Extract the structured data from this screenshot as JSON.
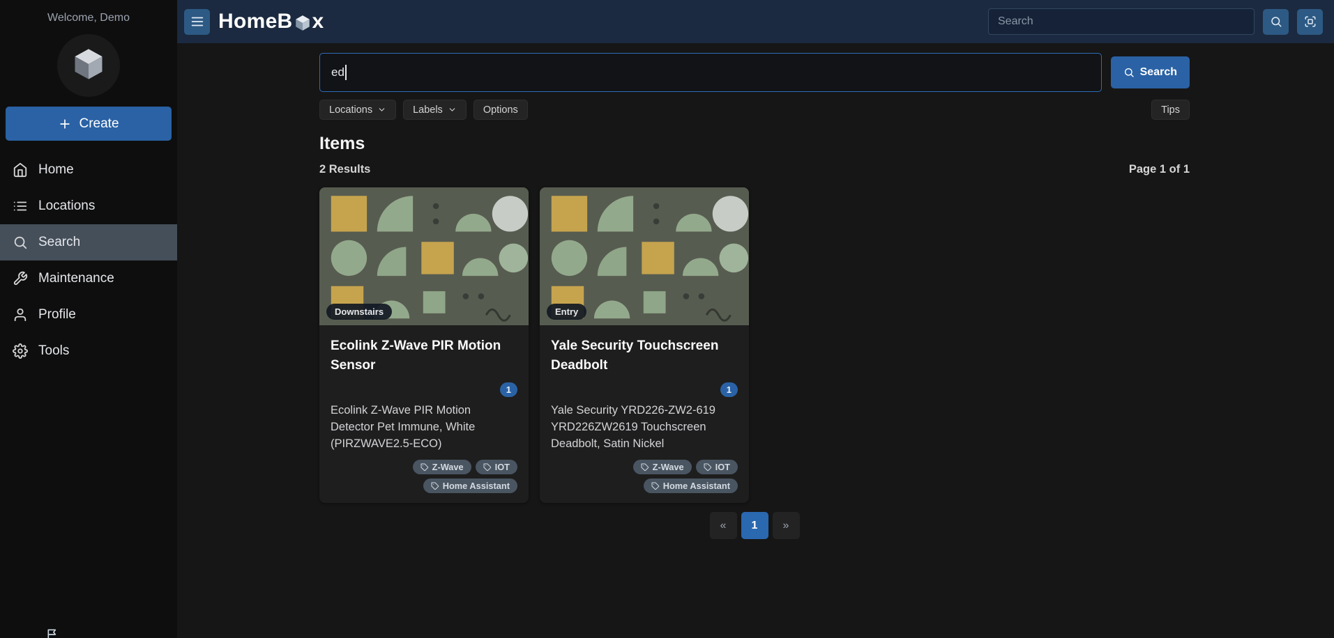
{
  "sidebar": {
    "welcome": "Welcome, Demo",
    "create_label": "Create",
    "items": [
      {
        "label": "Home"
      },
      {
        "label": "Locations"
      },
      {
        "label": "Search"
      },
      {
        "label": "Maintenance"
      },
      {
        "label": "Profile"
      },
      {
        "label": "Tools"
      }
    ]
  },
  "topbar": {
    "title_prefix": "HomeB",
    "title_suffix": "x",
    "search_placeholder": "Search"
  },
  "search_panel": {
    "query": "ed",
    "search_button": "Search",
    "filters": {
      "locations": "Locations",
      "labels": "Labels",
      "options": "Options"
    },
    "tips": "Tips"
  },
  "results": {
    "heading": "Items",
    "count_text": "2 Results",
    "page_text": "Page 1 of 1",
    "items": [
      {
        "location": "Downstairs",
        "title": "Ecolink Z-Wave PIR Motion Sensor",
        "quantity": "1",
        "description": "Ecolink Z-Wave PIR Motion Detector Pet Immune, White (PIRZWAVE2.5-ECO)",
        "labels": [
          "Z-Wave",
          "IOT",
          "Home Assistant"
        ]
      },
      {
        "location": "Entry",
        "title": "Yale Security Touchscreen Deadbolt",
        "quantity": "1",
        "description": "Yale Security YRD226-ZW2-619 YRD226ZW2619 Touchscreen Deadbolt, Satin Nickel",
        "labels": [
          "Z-Wave",
          "IOT",
          "Home Assistant"
        ]
      }
    ]
  },
  "pagination": {
    "prev": "«",
    "page": "1",
    "next": "»"
  },
  "colors": {
    "primary": "#2a62a5",
    "topbar_bg": "#1b2a40",
    "sidebar_bg": "#0e0e0e",
    "page_bg": "#161616",
    "card_bg": "#1e1e1e",
    "active_nav_bg": "#454f5a",
    "focus_border": "#2e6cb8"
  }
}
